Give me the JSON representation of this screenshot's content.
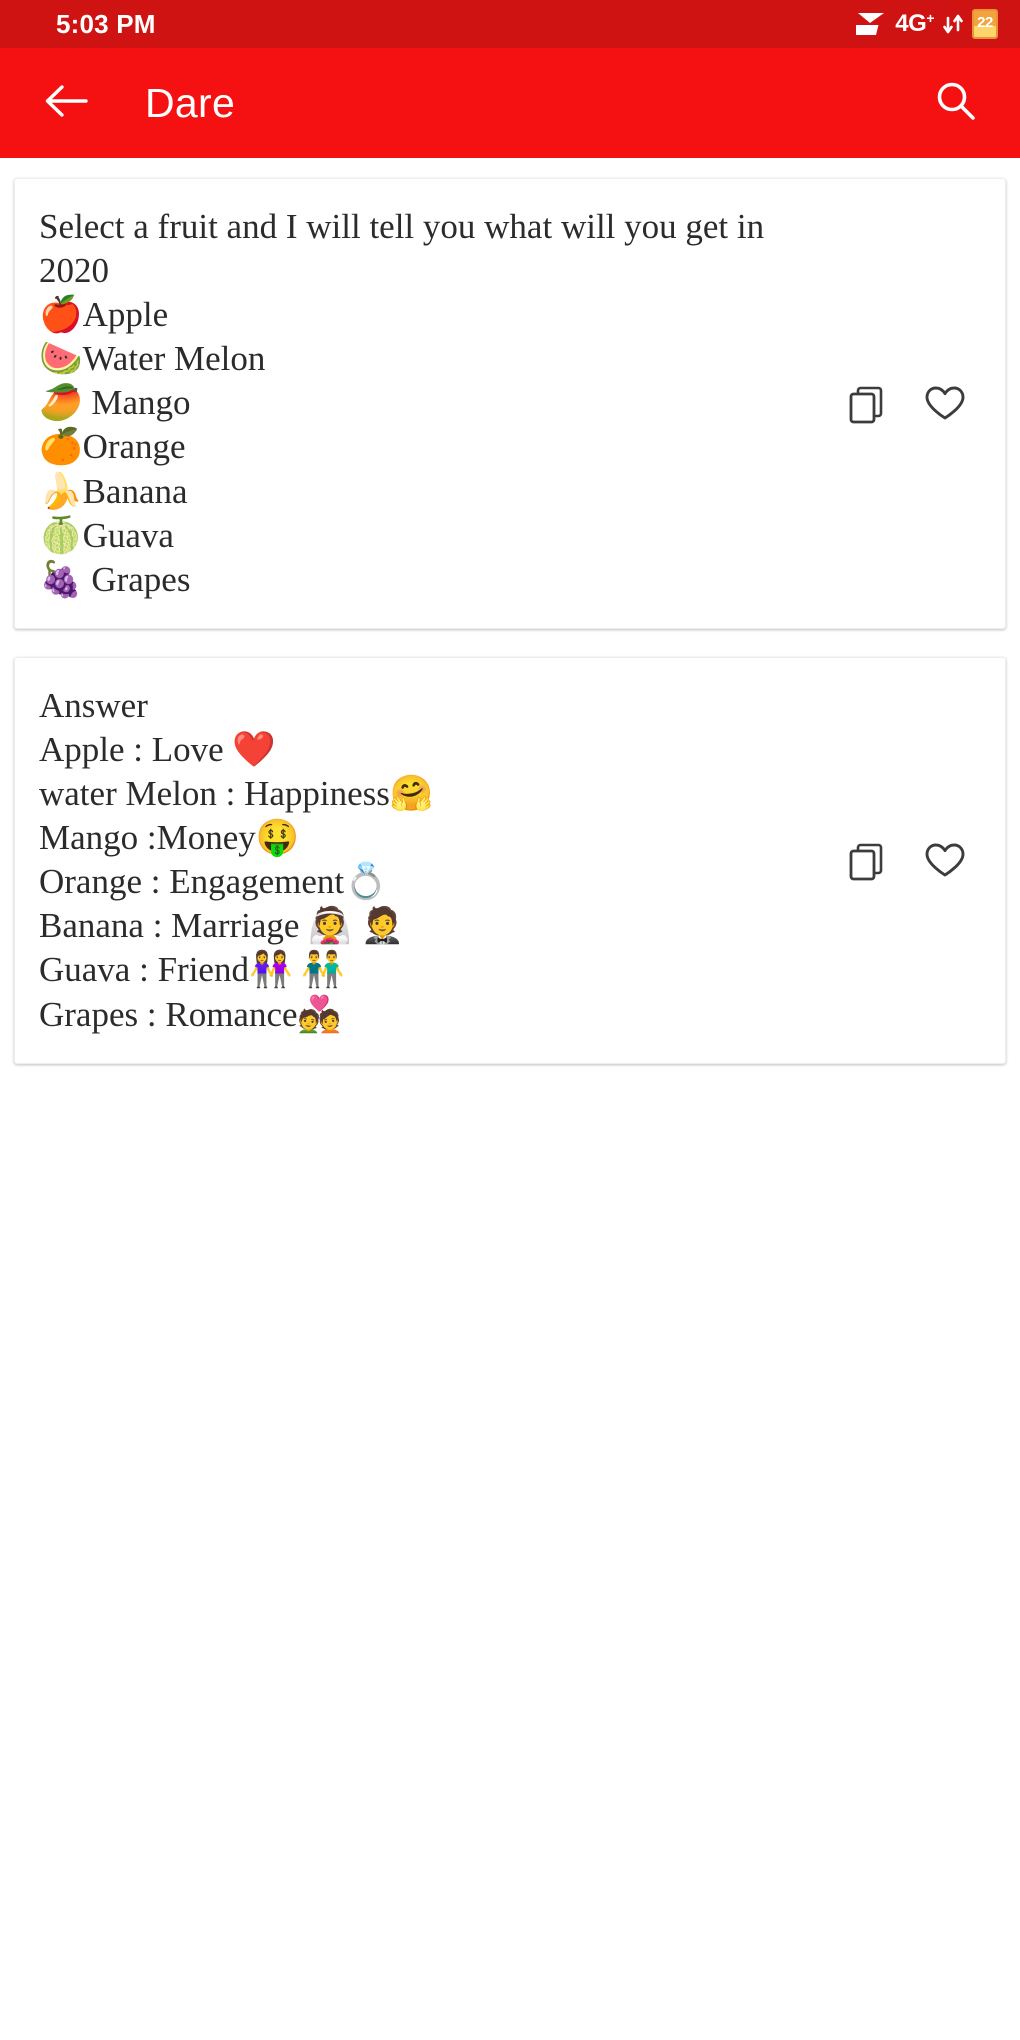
{
  "status_bar": {
    "time": "5:03 PM",
    "network_label": "4G",
    "network_superscript": "+",
    "battery_level": "22",
    "background_color": "#ce1312",
    "icons": [
      "signal-icon",
      "data-transfer-icon",
      "battery-icon"
    ]
  },
  "toolbar": {
    "title": "Dare",
    "back_icon": "back-arrow-icon",
    "search_icon": "search-icon",
    "background_color": "#f51111",
    "text_color": "#ffffff"
  },
  "cards": [
    {
      "id": "fruit-question-card",
      "text": "Select a fruit and I will tell you what will you get in 2020\n🍎Apple\n🍉Water Melon\n🥭 Mango\n🍊Orange\n🍌Banana\n🍈Guava\n🍇 Grapes",
      "copy_label": "copy-icon",
      "favorite_label": "heart-icon",
      "favorited": false
    },
    {
      "id": "fruit-answer-card",
      "text": "Answer\nApple : Love ❤️\nwater Melon : Happiness🤗\nMango :Money🤑\nOrange : Engagement💍\nBanana : Marriage 👰 🤵\nGuava : Friend👭 👬\nGrapes : Romance💑",
      "copy_label": "copy-icon",
      "favorite_label": "heart-icon",
      "favorited": false
    }
  ],
  "theme": {
    "page_background": "#ffffff",
    "card_background": "#ffffff",
    "card_text_color": "#2b2b2b",
    "icon_color": "#3c3c3c"
  }
}
